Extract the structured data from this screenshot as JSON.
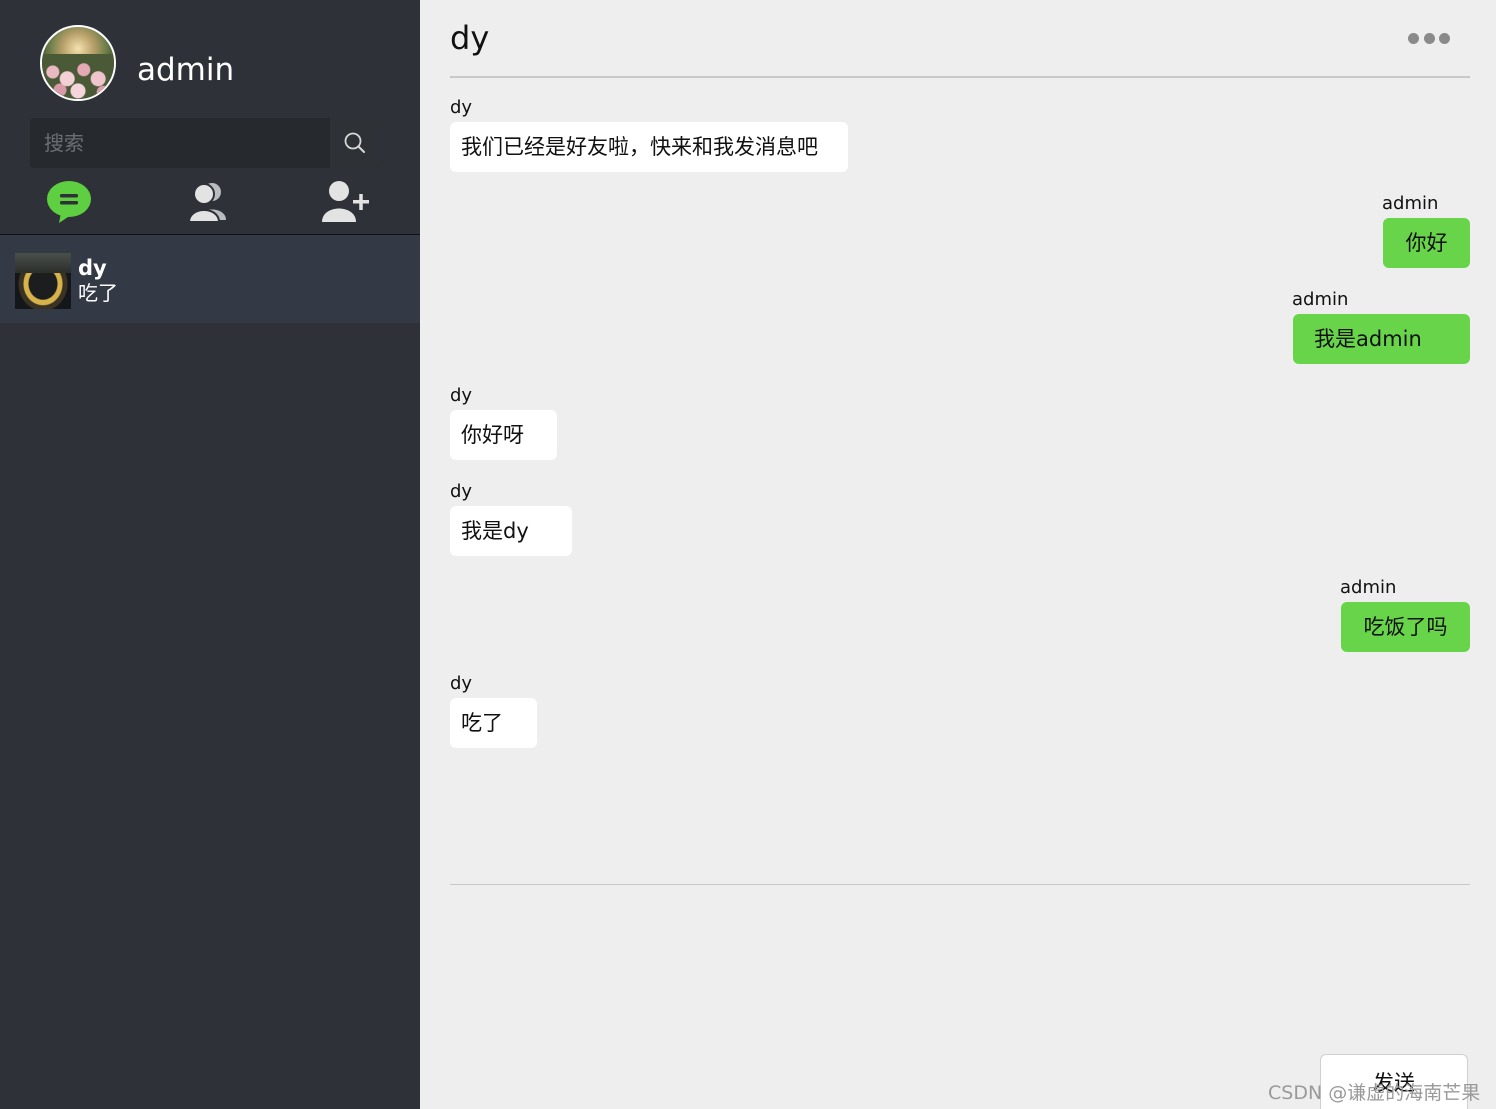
{
  "user": {
    "name": "admin"
  },
  "search": {
    "placeholder": "搜索"
  },
  "nav": {
    "tabs": [
      "chat-icon",
      "contacts-icon",
      "add-friend-icon"
    ],
    "accent": "#5fcf42"
  },
  "conversations": [
    {
      "name": "dy",
      "last_message": "吃了"
    }
  ],
  "chat": {
    "title": "dy",
    "messages": [
      {
        "sender": "dy",
        "text": "我们已经是好友啦，快来和我发消息吧",
        "side": "left"
      },
      {
        "sender": "admin",
        "text": "你好",
        "side": "right"
      },
      {
        "sender": "admin",
        "text": "我是admin",
        "side": "right"
      },
      {
        "sender": "dy",
        "text": "你好呀",
        "side": "left"
      },
      {
        "sender": "dy",
        "text": "我是dy",
        "side": "left"
      },
      {
        "sender": "admin",
        "text": "吃饭了吗",
        "side": "right"
      },
      {
        "sender": "dy",
        "text": "吃了",
        "side": "left"
      }
    ]
  },
  "compose": {
    "value": "",
    "send_label": "发送"
  },
  "colors": {
    "sidebar": "#2e3238",
    "my_bubble": "#67d44a",
    "their_bubble": "#ffffff",
    "chat_bg": "#eeeeee"
  },
  "watermark": "CSDN @谦虚的海南芒果"
}
